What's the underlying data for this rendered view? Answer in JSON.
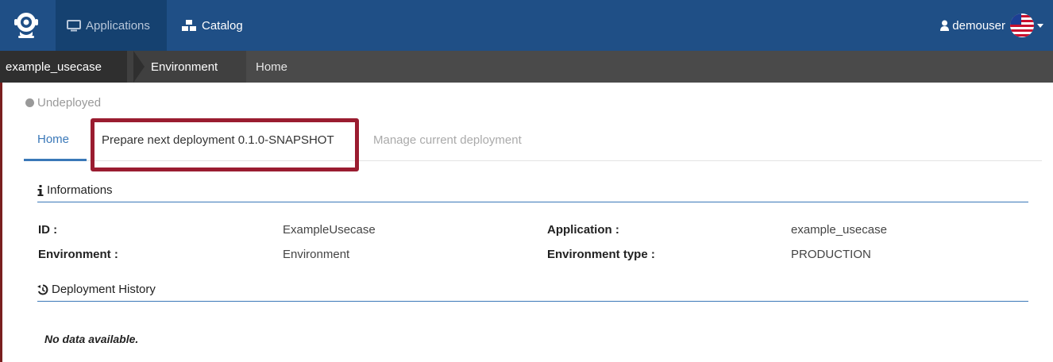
{
  "navbar": {
    "nav_items": [
      {
        "label": "Applications",
        "icon": "monitor-icon",
        "active": true
      },
      {
        "label": "Catalog",
        "icon": "cubes-icon",
        "active": false
      }
    ],
    "user": {
      "name": "demouser",
      "icon": "user-icon",
      "flag": "us-flag-icon"
    }
  },
  "breadcrumb": {
    "items": [
      "example_usecase",
      "Environment",
      "Home"
    ]
  },
  "status": {
    "label": "Undeployed",
    "color": "#999999"
  },
  "tabs": [
    {
      "label": "Home",
      "active": true
    },
    {
      "label": "Prepare next deployment 0.1.0-SNAPSHOT",
      "highlighted": true
    },
    {
      "label": "Manage current deployment",
      "disabled": true
    }
  ],
  "informations": {
    "title": "Informations",
    "fields": [
      {
        "label": "ID :",
        "value": "ExampleUsecase"
      },
      {
        "label": "Environment :",
        "value": "Environment"
      },
      {
        "label": "Application :",
        "value": "example_usecase"
      },
      {
        "label": "Environment type :",
        "value": "PRODUCTION"
      }
    ]
  },
  "history": {
    "title": "Deployment History",
    "empty_message": "No data available."
  },
  "colors": {
    "navbar": "#1f4f86",
    "breadcrumb": "#4a4a4a",
    "accent": "#3a78b8",
    "highlight": "#9a1c30"
  }
}
